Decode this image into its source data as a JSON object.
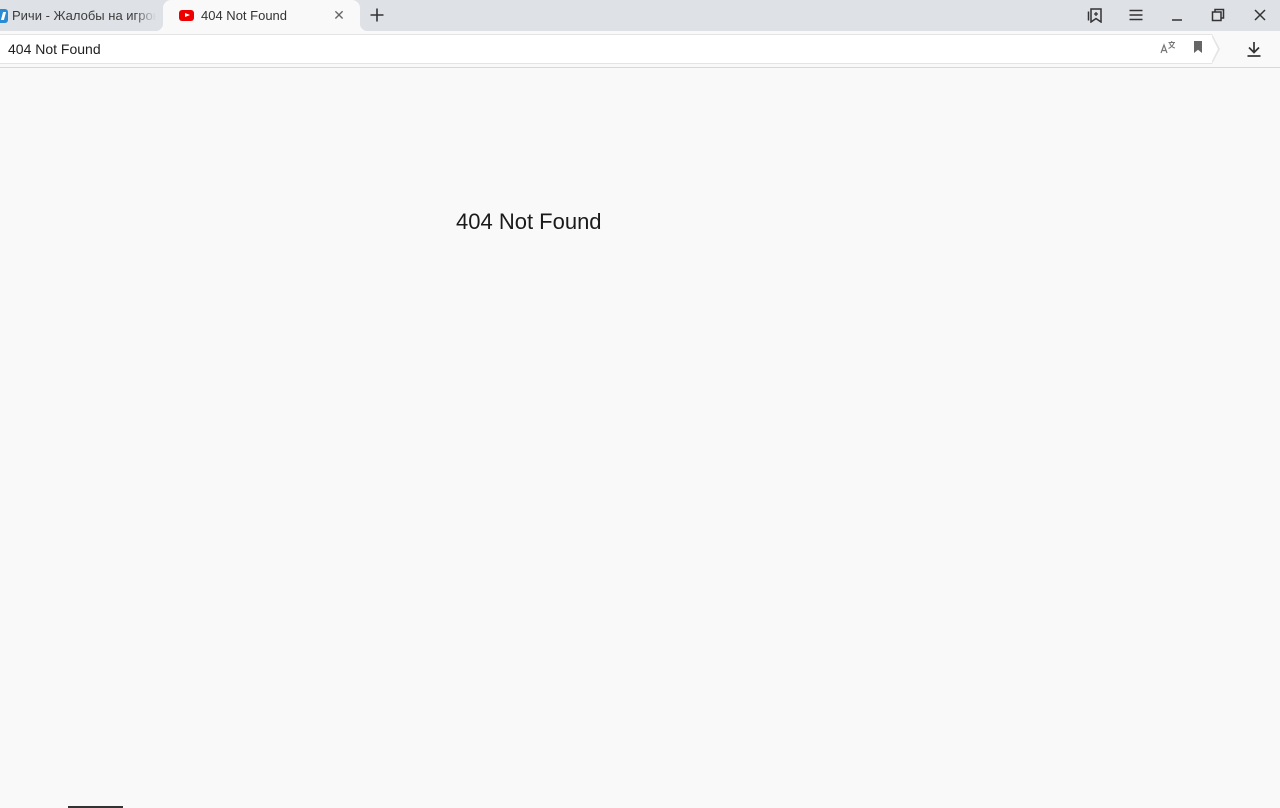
{
  "tabs": [
    {
      "title": "Ричи - Жалобы на игроков",
      "favicon": "forum-favicon",
      "active": false
    },
    {
      "title": "404 Not Found",
      "favicon": "youtube-icon",
      "active": true
    }
  ],
  "tab_close_glyph": "✕",
  "address_bar": {
    "text": "404 Not Found"
  },
  "page": {
    "heading": "404 Not Found"
  },
  "icons": {
    "collections": "bookmarks-collection-icon",
    "menu": "hamburger-menu-icon",
    "minimize": "minimize-icon",
    "restore": "restore-icon",
    "close": "close-icon",
    "translate": "translate-icon",
    "bookmark": "bookmark-icon",
    "download": "download-icon",
    "new_tab": "plus-icon"
  },
  "colors": {
    "tabstrip": "#dee1e6",
    "page_background": "#f9f9f9",
    "youtube_red": "#ee0000"
  }
}
